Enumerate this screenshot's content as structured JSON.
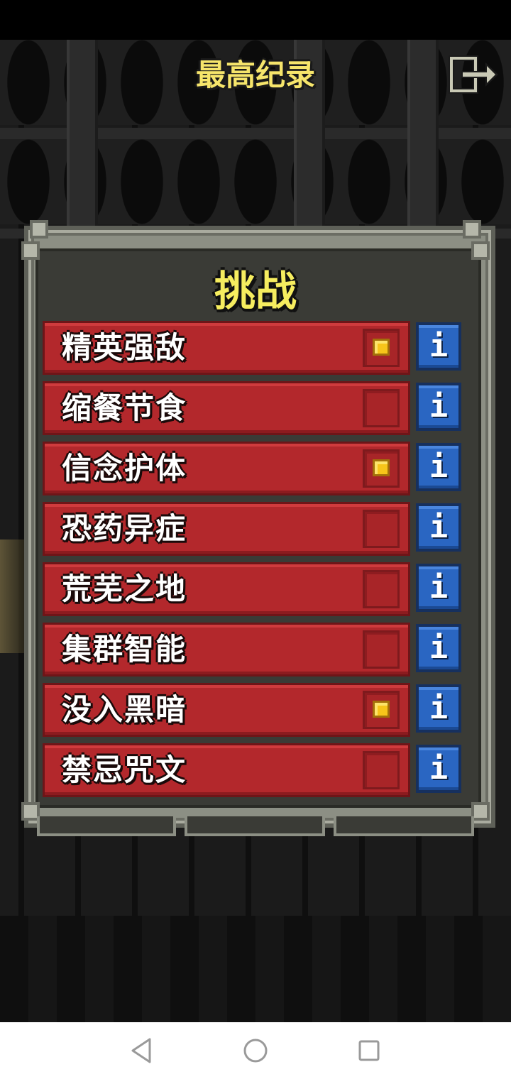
{
  "header": {
    "title": "最高纪录",
    "exit_icon": "exit-icon"
  },
  "panel": {
    "title": "挑战",
    "challenges": [
      {
        "label": "精英强敌",
        "checked": true
      },
      {
        "label": "缩餐节食",
        "checked": false
      },
      {
        "label": "信念护体",
        "checked": true
      },
      {
        "label": "恐药异症",
        "checked": false
      },
      {
        "label": "荒芜之地",
        "checked": false
      },
      {
        "label": "集群智能",
        "checked": false
      },
      {
        "label": "没入黑暗",
        "checked": true
      },
      {
        "label": "禁忌咒文",
        "checked": false
      }
    ],
    "info_label": "i"
  },
  "nav": {
    "back_icon": "back-triangle-icon",
    "home_icon": "home-circle-icon",
    "recents_icon": "recents-square-icon"
  },
  "colors": {
    "title_yellow": "#f6e56b",
    "row_red": "#b3282c",
    "info_blue": "#2a66c2",
    "check_gold": "#f7c51a"
  }
}
